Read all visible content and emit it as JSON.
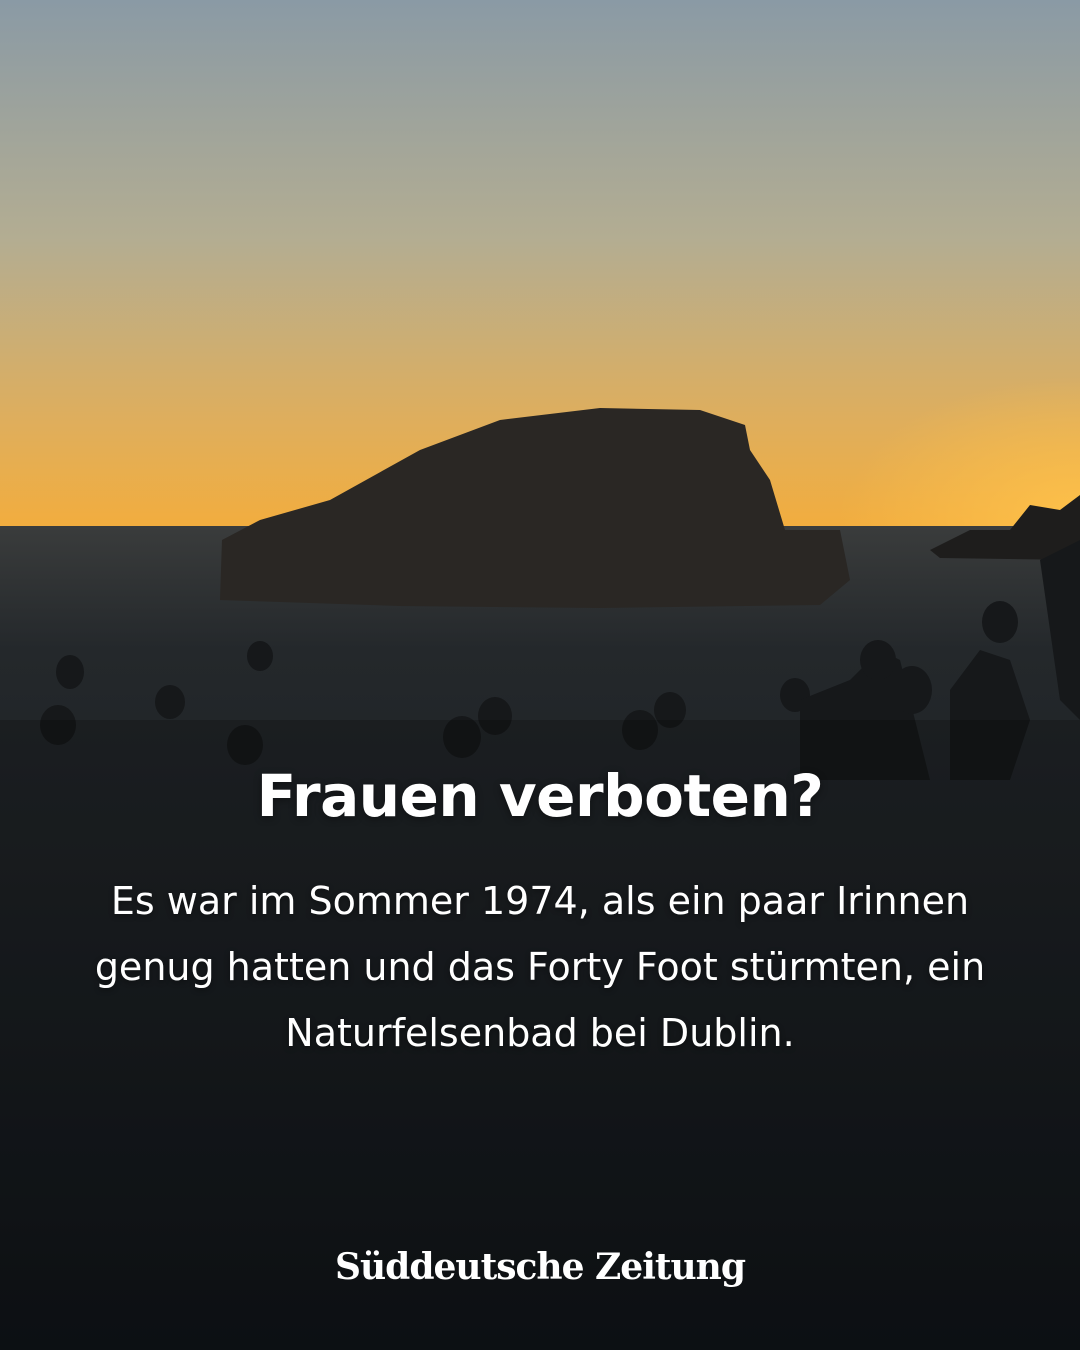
{
  "post": {
    "headline": "Frauen verboten?",
    "body": "Es war im Sommer 1974, als ein paar Irinnen genug hatten und das Forty Foot stürmten, ein Naturfelsenbad bei Dublin.",
    "logo_text": "Süddeutsche Zeitung"
  },
  "colors": {
    "sky_top": "#8d9ba4",
    "sky_horizon": "#efac45",
    "sea": "#1a1f24",
    "text": "#ffffff"
  }
}
